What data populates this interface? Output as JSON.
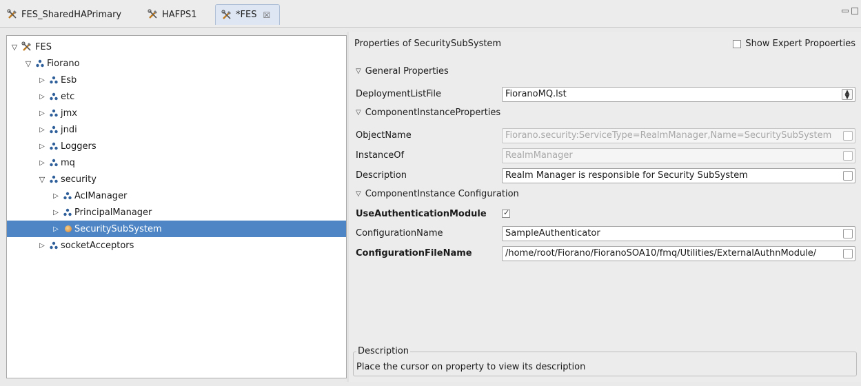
{
  "tabs": [
    {
      "label": "FES_SharedHAPrimary",
      "active": false
    },
    {
      "label": "HAFPS1",
      "active": false
    },
    {
      "label": "*FES",
      "active": true,
      "close": "☒"
    }
  ],
  "tree": {
    "nodes": [
      {
        "label": "FES",
        "toggle": "▽",
        "icon": "tools-icon"
      },
      {
        "label": "Fiorano",
        "toggle": "▽",
        "icon": "cluster-icon"
      },
      {
        "label": "Esb",
        "toggle": "▷",
        "icon": "cluster-icon"
      },
      {
        "label": "etc",
        "toggle": "▷",
        "icon": "cluster-icon"
      },
      {
        "label": "jmx",
        "toggle": "▷",
        "icon": "cluster-icon"
      },
      {
        "label": "jndi",
        "toggle": "▷",
        "icon": "cluster-icon"
      },
      {
        "label": "Loggers",
        "toggle": "▷",
        "icon": "cluster-icon"
      },
      {
        "label": "mq",
        "toggle": "▷",
        "icon": "cluster-icon"
      },
      {
        "label": "security",
        "toggle": "▽",
        "icon": "cluster-icon"
      },
      {
        "label": "AclManager",
        "toggle": "▷",
        "icon": "cluster-icon"
      },
      {
        "label": "PrincipalManager",
        "toggle": "▷",
        "icon": "cluster-icon"
      },
      {
        "label": "SecuritySubSystem",
        "toggle": "▷",
        "icon": "bean-icon",
        "selected": true
      },
      {
        "label": "socketAcceptors",
        "toggle": "▷",
        "icon": "cluster-icon"
      }
    ]
  },
  "properties": {
    "title": "Properties of SecuritySubSystem",
    "expert_label": "Show Expert Propoerties",
    "expert_checked": false,
    "sections": {
      "general": "General Properties",
      "instance_props": "ComponentInstanceProperties",
      "instance_config": "ComponentInstance Configuration"
    },
    "rows": {
      "deployment": {
        "label": "DeploymentListFile",
        "value": "FioranoMQ.lst"
      },
      "object_name": {
        "label": "ObjectName",
        "value": "Fiorano.security:ServiceType=RealmManager,Name=SecuritySubSystem"
      },
      "instance_of": {
        "label": "InstanceOf",
        "value": "RealmManager"
      },
      "description": {
        "label": "Description",
        "value": "Realm Manager is responsible for Security SubSystem"
      },
      "use_auth": {
        "label": "UseAuthenticationModule",
        "checked": true
      },
      "config_name": {
        "label": "ConfigurationName",
        "value": "SampleAuthenticator"
      },
      "config_file": {
        "label": "ConfigurationFileName",
        "value": "/home/root/Fiorano/FioranoSOA10/fmq/Utilities/ExternalAuthnModule/"
      }
    },
    "description_box": {
      "legend": "Description",
      "text": "Place the cursor on property to view its description"
    }
  },
  "colors": {
    "selection": "#4e86c5",
    "cluster_icon": "#2f5f9a"
  }
}
